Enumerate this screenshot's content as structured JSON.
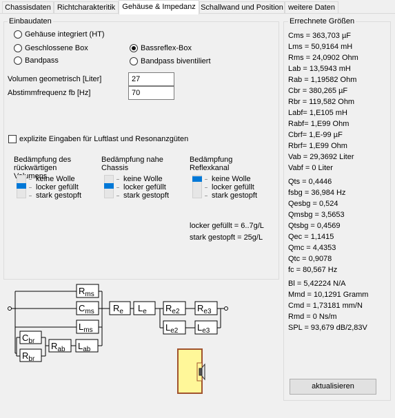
{
  "tabs": [
    {
      "label": "Chassisdaten"
    },
    {
      "label": "Richtcharakteritik"
    },
    {
      "label": "Gehäuse & Impedanz"
    },
    {
      "label": "Schallwand und Position"
    },
    {
      "label": "weitere Daten"
    }
  ],
  "input_group": {
    "title": "Einbaudaten",
    "radios": [
      {
        "label": "Gehäuse integriert (HT)",
        "selected": false
      },
      {
        "label": "Geschlossene Box",
        "selected": false
      },
      {
        "label": "Bandpass",
        "selected": false
      },
      {
        "label": "Bassreflex-Box",
        "selected": true
      },
      {
        "label": "Bandpass biventiliert",
        "selected": false
      }
    ],
    "volume_label": "Volumen geometrisch [Liter]",
    "volume_value": "27",
    "fb_label": "Abstimmfrequenz fb [Hz]",
    "fb_value": "70",
    "explicit_label": "explizite Eingaben für Luftlast und Resonanzgüten",
    "explicit_checked": false,
    "damping": [
      {
        "title_line1": "Bedämpfung des",
        "title_line2": "rückwärtigen",
        "title_line3": "Volumens",
        "level": 0
      },
      {
        "title_line1": "Bedämpfung nahe",
        "title_line2": "Chassis",
        "title_line3": "",
        "level": 0
      },
      {
        "title_line1": "Bedämpfung",
        "title_line2": "Reflexkanal",
        "title_line3": "",
        "level": 0
      }
    ],
    "damping_options": [
      "keine Wolle",
      "locker gefüllt",
      "stark gestopft"
    ],
    "note_line1": "locker gefüllt = 6..7g/L",
    "note_line2": "stark gestopft = 25g/L"
  },
  "results": {
    "title": "Errechnete Größen",
    "lines": [
      "Cms = 363,703 µF",
      "Lms = 50,9164 mH",
      "Rms = 24,0902 Ohm",
      "Lab = 13,5943 mH",
      "Rab = 1,19582 Ohm",
      "Cbr = 380,265 µF",
      "Rbr = 119,582 Ohm",
      "Labf= 1,E105 mH",
      "Rabf= 1,E99 Ohm",
      "Cbrf= 1,E-99 µF",
      "Rbrf= 1,E99 Ohm",
      "Vab = 29,3692 Liter",
      "Vabf = 0 Liter",
      "Qts = 0,4446",
      "fsbg = 36,984 Hz",
      "Qesbg = 0,524",
      "Qmsbg = 3,5653",
      "Qtsbg = 0,4569",
      "Qec = 1,1415",
      "Qmc = 4,4353",
      "Qtc = 0,9078",
      "fc  = 80,567 Hz",
      "Bl  = 5,42224 N/A",
      "Mmd = 10,1291 Gramm",
      "Cmd = 1,73181 mm/N",
      "Rmd = 0 Ns/m",
      "SPL = 93,679 dB/2,83V"
    ],
    "update_button": "aktualisieren"
  },
  "circuit": {
    "Rms": [
      "R",
      "ms"
    ],
    "Cms": [
      "C",
      "ms"
    ],
    "Lms": [
      "L",
      "ms"
    ],
    "Re": [
      "R",
      "e"
    ],
    "Le": [
      "L",
      "e"
    ],
    "Re2": [
      "R",
      "e2"
    ],
    "Re3": [
      "R",
      "e3"
    ],
    "Le2": [
      "L",
      "e2"
    ],
    "Le3": [
      "L",
      "e3"
    ],
    "Cbr": [
      "C",
      "br"
    ],
    "Rbr": [
      "R",
      "br"
    ],
    "Rab": [
      "R",
      "ab"
    ],
    "Lab": [
      "L",
      "ab"
    ]
  },
  "colors": {
    "accent": "#0078d7",
    "enclosure_fill": "#fff799",
    "enclosure_stroke": "#a0522d"
  }
}
